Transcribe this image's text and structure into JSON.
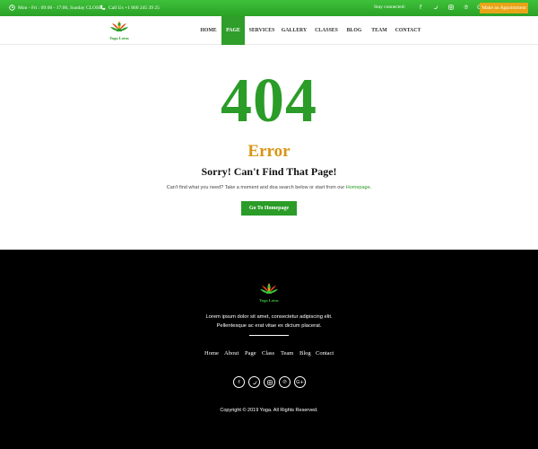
{
  "topbar": {
    "hours": "Mon - Fri : 09:00 - 17:00, Sunday CLOSE",
    "phone": "Call Us +1 800 245 39 25",
    "stay_connected": "Stay connected:",
    "appointment_label": "Make an Appointment",
    "social_icons": [
      "facebook-icon",
      "twitter-icon",
      "instagram-icon",
      "pinterest-icon",
      "google-plus-icon"
    ]
  },
  "brand": {
    "logo_text": "Yoga Lotus"
  },
  "nav": {
    "items": [
      "HOME",
      "PAGE",
      "SERVICES",
      "GALLERY",
      "CLASSES",
      "BLOG",
      "TEAM",
      "CONTACT"
    ],
    "active": "PAGE"
  },
  "error": {
    "code": "404",
    "title": "Error",
    "heading": "Sorry! Can't Find That Page!",
    "message_prefix": "Can't find what you need? Take a moment and doa search below or start from our ",
    "message_link": "Homepage",
    "message_suffix": ".",
    "button_label": "Go To Homepage"
  },
  "footer": {
    "logo_text": "Yoga Lotus",
    "para_line1": "Lorem ipsum dolor sit amet, consectetur adipiscing elit.",
    "para_line2": "Pellentesque ac erat vitae ex dictum placerat.",
    "nav": [
      "Home",
      "About",
      "Page",
      "Class",
      "Team",
      "Blog",
      "Contact"
    ],
    "social_icons": [
      "facebook-icon",
      "twitter-icon",
      "instagram-icon",
      "pinterest-icon",
      "google-plus-icon"
    ],
    "copyright": "Copyright © 2019 Yoga. All Rights Reserved."
  },
  "colors": {
    "green": "#2a9c27",
    "orange": "#d99516",
    "black": "#000000"
  }
}
